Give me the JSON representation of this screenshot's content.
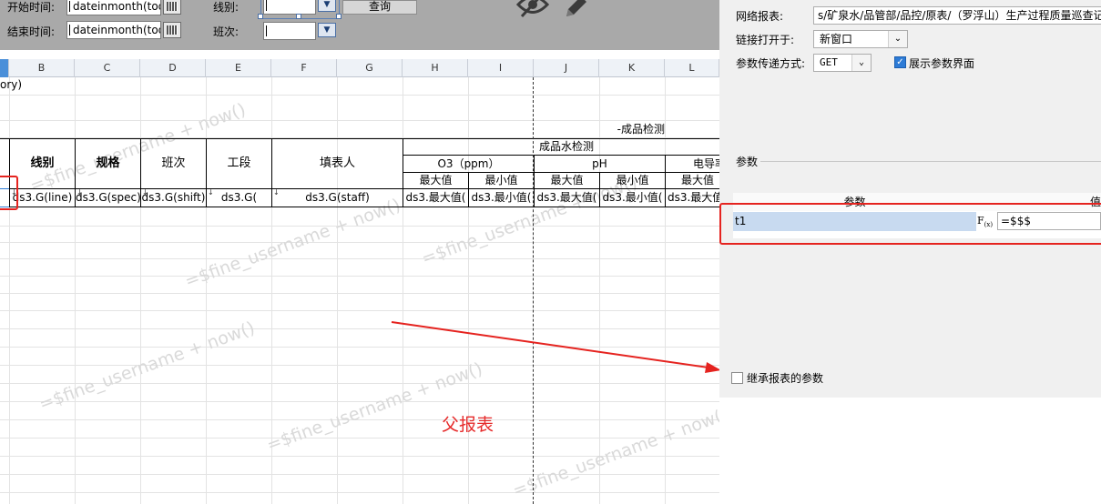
{
  "param_panel": {
    "start_time_label": "开始时间:",
    "start_time_value": "dateinmonth(tod",
    "end_time_label": "结束时间:",
    "end_time_value": "dateinmonth(tod",
    "line_label": "线别:",
    "shift_label": "班次:",
    "query_button": "查询",
    "icons": [
      "eye-slash-icon",
      "pencil-icon"
    ]
  },
  "columns": [
    "B",
    "C",
    "D",
    "E",
    "F",
    "G",
    "H",
    "I",
    "J",
    "K",
    "L"
  ],
  "report": {
    "row1_text": "ory)",
    "title_product_check": "-成品检测",
    "title_water_check": "成品水检测",
    "headers": {
      "line": "线别",
      "spec": "规格",
      "shift": "班次",
      "section": "工段",
      "filler": "填表人",
      "o3": "O3（ppm）",
      "ph": "pH",
      "conductivity": "电导率",
      "max": "最大值",
      "min": "最小值"
    },
    "data_row": [
      "ds3.G(line)",
      "ds3.G(spec)",
      "ds3.G(shift)",
      "ds3.G(",
      "ds3.G(staff)",
      "ds3.最大值(",
      "ds3.最小值(",
      "ds3.最大值(",
      "ds3.最小值(",
      "ds3.最大值("
    ],
    "watermark": "=$fine_username + now()",
    "parent_report_label": "父报表"
  },
  "dialog": {
    "network_report_label": "网络报表:",
    "network_report_path": "s/矿泉水/品管部/品控/原表/（罗浮山）生产过程质量巡查记录",
    "open_in_label": "链接打开于:",
    "open_in_value": "新窗口",
    "pass_method_label": "参数传递方式:",
    "pass_method_value": "GET",
    "show_param_ui_label": "展示参数界面",
    "show_param_ui_checked": true,
    "params_section_label": "参数",
    "table_headers": [
      "参数",
      "值"
    ],
    "param_rows": [
      {
        "name": "t1",
        "value": "=$$$"
      }
    ],
    "inherit_label": "继承报表的参数",
    "inherit_checked": false
  },
  "colors": {
    "accent_red": "#e5231f",
    "selection_blue": "#c8daf0",
    "checkbox_blue": "#2d7bd6"
  }
}
